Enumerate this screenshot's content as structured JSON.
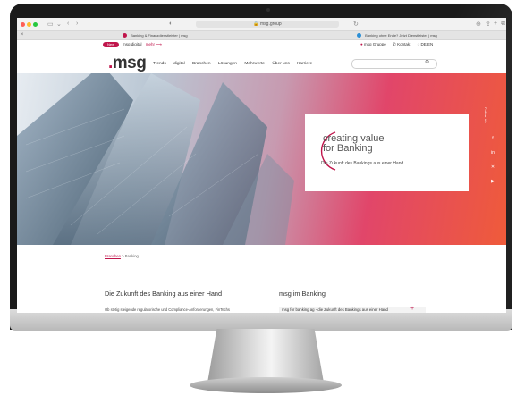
{
  "browser": {
    "url": "msg.group",
    "tabs": [
      {
        "title": "Banking & Finanzdienstleister | msg"
      },
      {
        "title": "Banking ohne Ende? Jetzt Dienstleister | msg"
      }
    ]
  },
  "site": {
    "new_badge": "New",
    "topbar_link": "msg digital",
    "topbar_more": "mehr",
    "topbar_right": [
      "msg Gruppe",
      "Kontakt",
      "DE/EN"
    ],
    "logo": "msg",
    "nav": [
      "Trends",
      "digital",
      "Branchen",
      "Lösungen",
      "Mehrwerte",
      "Über uns",
      "Karriere"
    ],
    "search_placeholder": ""
  },
  "hero": {
    "title_line1": "creating value",
    "title_line2": "for Banking",
    "subtitle": "Die Zukunft des Bankings aus einer Hand",
    "follow_label": "Follow Us"
  },
  "breadcrumb": {
    "home": "Branchen",
    "current": "Banking"
  },
  "content": {
    "main_heading": "Die Zukunft des Banking aus einer Hand",
    "side_heading": "msg im Banking",
    "body_text": "Ob stetig steigende regulatorische und Compliance-Anforderungen, FinTechs",
    "link_item": "msg for banking ag - die Zukunft des Bankings aus einer Hand",
    "link_plus": "+"
  },
  "colors": {
    "brand": "#c0154b",
    "hero_end": "#ef5b3a"
  }
}
